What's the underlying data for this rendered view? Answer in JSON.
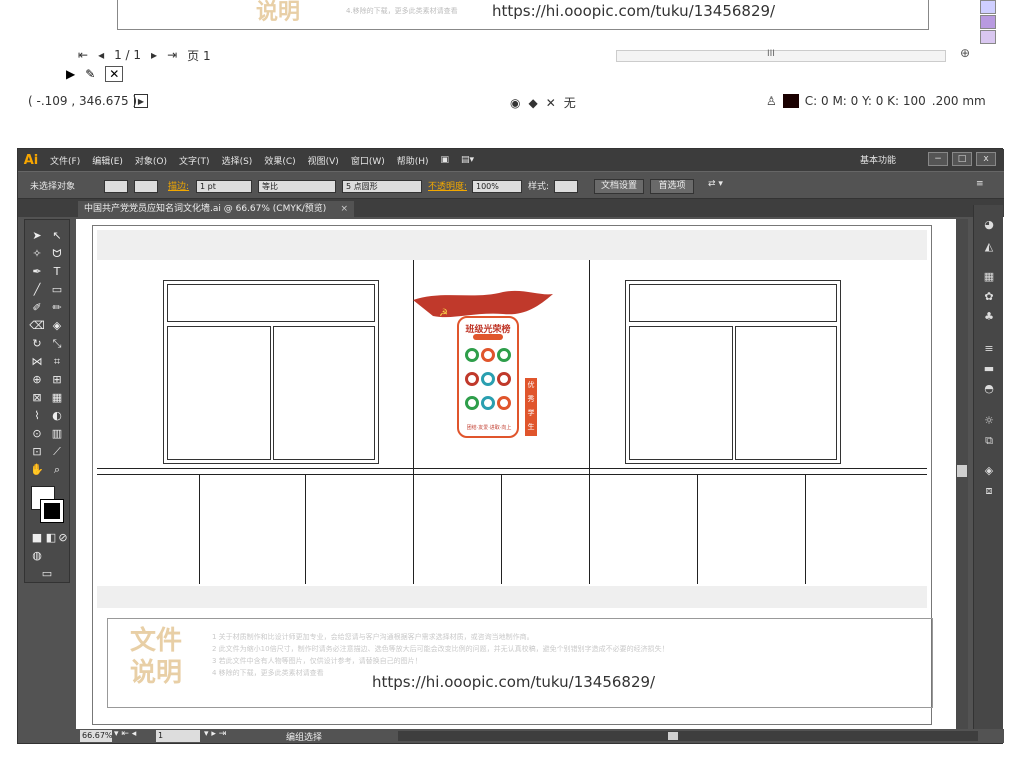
{
  "top_strip": {
    "doc_title_char": "说明",
    "doc_note": "4.移除的下载，更多此类素材请查看",
    "url": "https://hi.ooopic.com/tuku/13456829/",
    "page_nav": "1 / 1",
    "page_indicator": "页 1",
    "coords": "( -.109 , 346.675 )",
    "none_label": "无",
    "color_values": "C: 0 M: 0 Y: 0 K: 100",
    "stroke_width": ".200 mm",
    "swatch_colors": [
      "#cfcfff",
      "#b89ae0",
      "#d9c7f0"
    ]
  },
  "window": {
    "logo": "Ai",
    "menus": [
      "文件(F)",
      "编辑(E)",
      "对象(O)",
      "文字(T)",
      "选择(S)",
      "效果(C)",
      "视图(V)",
      "窗口(W)",
      "帮助(H)"
    ],
    "workspace": "基本功能",
    "win_min": "−",
    "win_max": "□",
    "win_close": "x"
  },
  "controlbar": {
    "selection_label": "未选择对象",
    "stroke_label": "描边:",
    "stroke_value": "1 pt",
    "brush_label": "等比",
    "point_label": "5 点圆形",
    "opacity_label": "不透明度:",
    "opacity_value": "100%",
    "style_label": "样式:",
    "doc_setup_button": "文档设置",
    "prefs_button": "首选项"
  },
  "tab": {
    "title": "中国共产党党员应知名词文化墙.ai @ 66.67% (CMYK/预览)",
    "close": "×"
  },
  "artboard": {
    "info_title": "文件说明",
    "info_lines": [
      "1 关于材质制作和比设计师更加专业，会给您请与客户沟通根据客户需求选择材质，或咨询当地制作商。",
      "2 此文件为缩小10倍尺寸，制作时请务必注意描边、选色等放大后可能会改变比例的问题，并无认真校稿，避免个别错别字造成不必要的经济损失！",
      "3 若此文件中含有人物等图片，仅供设计参考，请替换自己的图片！",
      "4 移除的下载，更多此类素材请查看"
    ],
    "url": "https://hi.ooopic.com/tuku/13456829/",
    "board_title": "班级光荣榜",
    "board_slogan": "团结·友爱·进取·向上",
    "board_side": "优秀学生"
  },
  "statusbar": {
    "zoom": "66.67%",
    "page": "1",
    "status": "编组选择"
  },
  "colors": {
    "app_dark": "#535353",
    "menu_dark": "#3c3c3c",
    "accent_orange": "#f2a800",
    "board_red": "#c0392b",
    "board_orange": "#e0552c"
  }
}
